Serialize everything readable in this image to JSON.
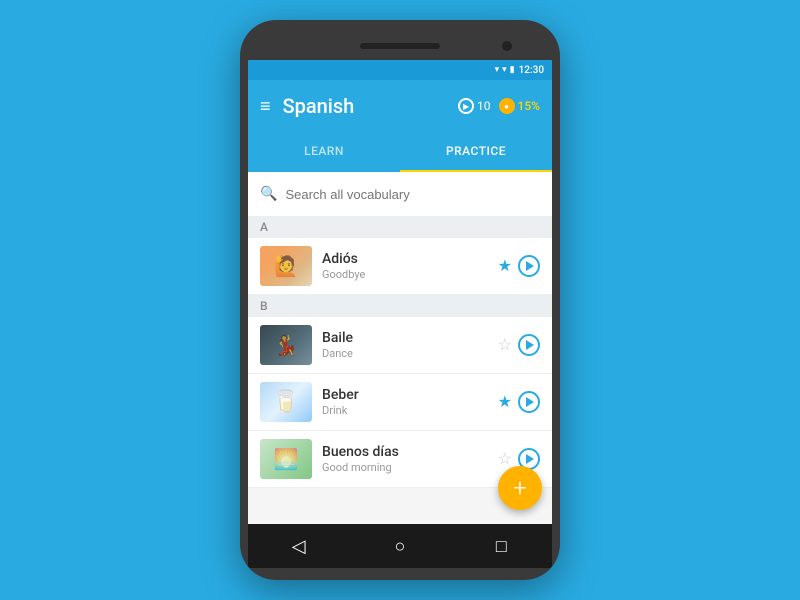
{
  "status_bar": {
    "time": "12:30",
    "wifi_icon": "▾",
    "signal_icon": "▾",
    "battery": "▮"
  },
  "app_bar": {
    "menu_icon": "≡",
    "title": "Spanish",
    "score_count": "10",
    "coins_percent": "15%"
  },
  "tabs": [
    {
      "id": "learn",
      "label": "LEARN",
      "active": false
    },
    {
      "id": "practice",
      "label": "PRACTICE",
      "active": true
    }
  ],
  "search": {
    "placeholder": "Search all vocabulary",
    "icon": "🔍"
  },
  "sections": [
    {
      "letter": "A",
      "items": [
        {
          "id": "adios",
          "word": "Adiós",
          "translation": "Goodbye",
          "starred": true,
          "thumb_class": "thumb-adios",
          "thumb_emoji": "🙋"
        }
      ]
    },
    {
      "letter": "B",
      "items": [
        {
          "id": "baile",
          "word": "Baile",
          "translation": "Dance",
          "starred": false,
          "thumb_class": "thumb-baile",
          "thumb_emoji": "💃"
        },
        {
          "id": "beber",
          "word": "Beber",
          "translation": "Drink",
          "starred": true,
          "thumb_class": "thumb-beber",
          "thumb_emoji": "🥛"
        },
        {
          "id": "buenos",
          "word": "Buenos días",
          "translation": "Good morning",
          "starred": false,
          "thumb_class": "thumb-buenos",
          "thumb_emoji": "🌅"
        }
      ]
    }
  ],
  "fab": {
    "icon": "+"
  },
  "bottom_nav": {
    "back_icon": "◁",
    "home_icon": "○",
    "recents_icon": "□"
  }
}
